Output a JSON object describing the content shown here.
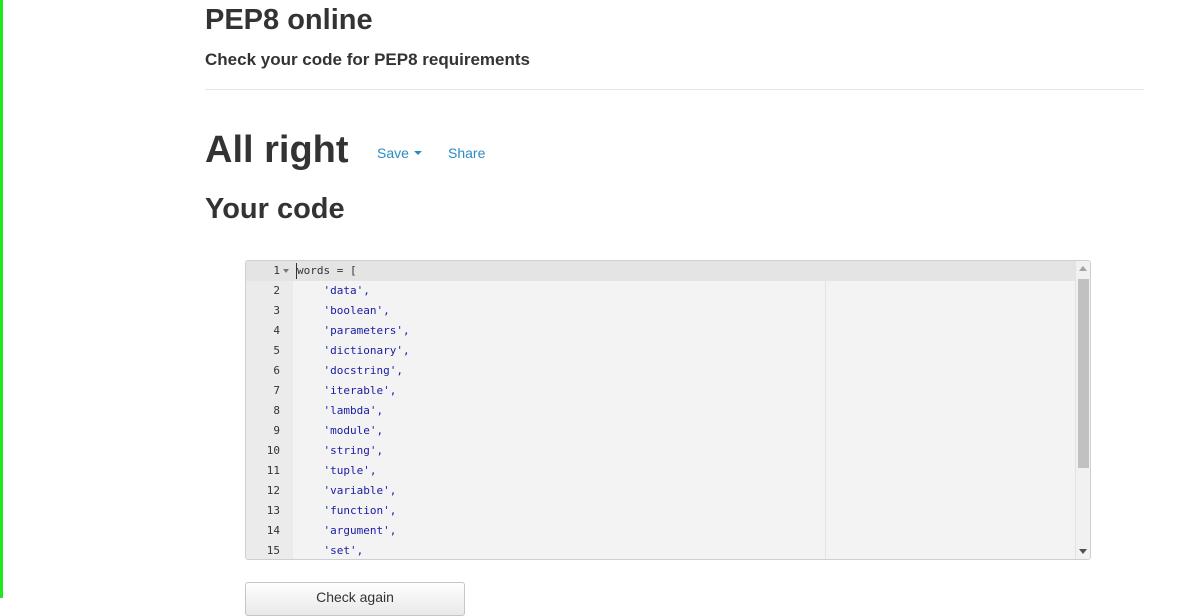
{
  "header": {
    "title": "PEP8 online",
    "subtitle": "Check your code for PEP8 requirements"
  },
  "result": {
    "status": "All right",
    "save_label": "Save",
    "share_label": "Share"
  },
  "code_section": {
    "heading": "Your code"
  },
  "editor": {
    "lines": [
      {
        "number": "1",
        "text": "words = [",
        "kind": "code"
      },
      {
        "number": "2",
        "text": "    'data',",
        "kind": "str"
      },
      {
        "number": "3",
        "text": "    'boolean',",
        "kind": "str"
      },
      {
        "number": "4",
        "text": "    'parameters',",
        "kind": "str"
      },
      {
        "number": "5",
        "text": "    'dictionary',",
        "kind": "str"
      },
      {
        "number": "6",
        "text": "    'docstring',",
        "kind": "str"
      },
      {
        "number": "7",
        "text": "    'iterable',",
        "kind": "str"
      },
      {
        "number": "8",
        "text": "    'lambda',",
        "kind": "str"
      },
      {
        "number": "9",
        "text": "    'module',",
        "kind": "str"
      },
      {
        "number": "10",
        "text": "    'string',",
        "kind": "str"
      },
      {
        "number": "11",
        "text": "    'tuple',",
        "kind": "str"
      },
      {
        "number": "12",
        "text": "    'variable',",
        "kind": "str"
      },
      {
        "number": "13",
        "text": "    'function',",
        "kind": "str"
      },
      {
        "number": "14",
        "text": "    'argument',",
        "kind": "str"
      },
      {
        "number": "15",
        "text": "    'set',",
        "kind": "str"
      }
    ]
  },
  "actions": {
    "check_again_label": "Check again"
  },
  "colors": {
    "link": "#2a8bc4",
    "string": "#1a1aa6",
    "accent_bar": "#1fe81f"
  }
}
